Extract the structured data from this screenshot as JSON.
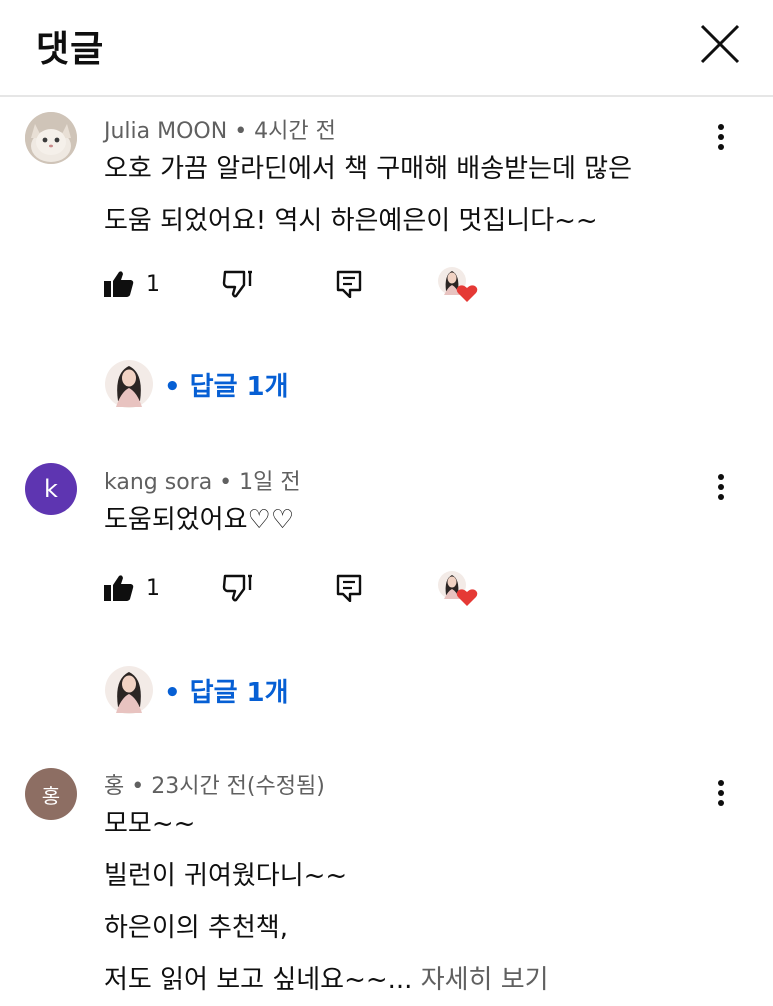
{
  "header": {
    "title": "댓글"
  },
  "comments": [
    {
      "author": "Julia MOON",
      "time": "4시간 전",
      "text_lines": [
        "오호 가끔 알라딘에서 책 구매해 배송받는데 많은",
        "도움 되었어요! 역시 하은예은이 멋집니다~~"
      ],
      "likes": "1",
      "replies_label": "• 답글 1개",
      "avatar": {
        "type": "photo",
        "icon": "cat-photo-icon"
      }
    },
    {
      "author": "kang sora",
      "time": "1일 전",
      "text_lines": [
        "도움되었어요♡♡"
      ],
      "likes": "1",
      "replies_label": "• 답글 1개",
      "avatar": {
        "type": "letter",
        "letter": "k",
        "color": "#5e35b1"
      }
    },
    {
      "author": "홍",
      "time": "23시간 전(수정됨)",
      "text_lines": [
        "모모~~",
        "빌런이 귀여웠다니~~",
        "하은이의 추천책,",
        "저도 읽어 보고 싶네요~~"
      ],
      "ellipsis": "...",
      "see_more": "자세히 보기",
      "avatar": {
        "type": "letter",
        "letter": "홍",
        "color": "#8d6e63"
      }
    }
  ],
  "separator": " • ",
  "colors": {
    "link": "#065fd4",
    "meta": "#606060",
    "heart": "#e53935"
  }
}
